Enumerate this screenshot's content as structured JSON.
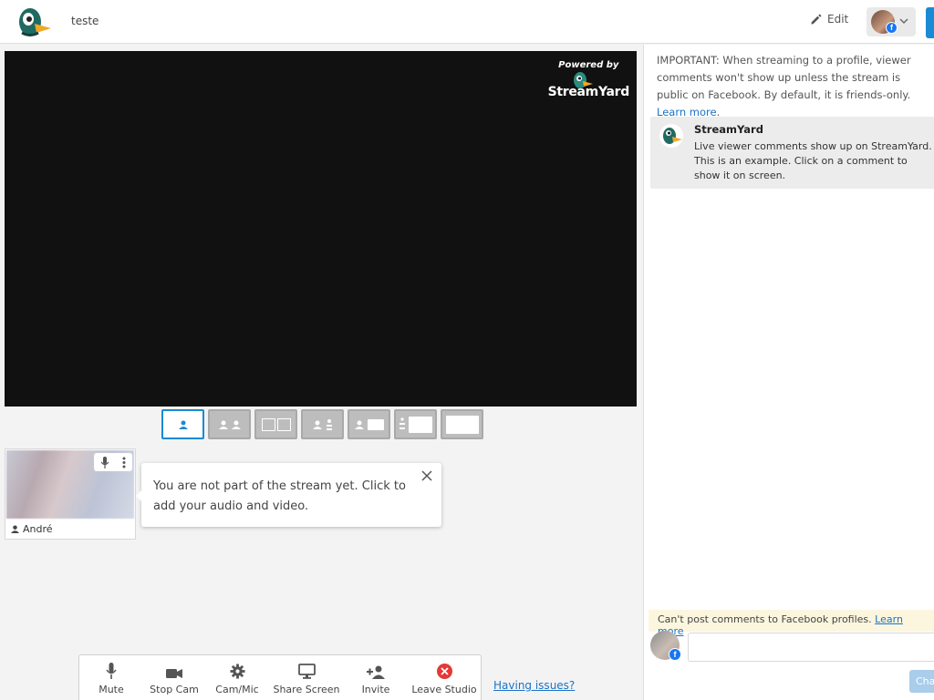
{
  "header": {
    "title": "teste",
    "edit_label": "Edit"
  },
  "stage": {
    "powered_by": "Powered by",
    "brand": "StreamYard"
  },
  "participant": {
    "name": "André"
  },
  "tooltip": {
    "text": "You are not part of the stream yet. Click to add your audio and video."
  },
  "toolbar": {
    "mute": "Mute",
    "stop_cam": "Stop Cam",
    "cam_mic": "Cam/Mic",
    "share_screen": "Share Screen",
    "invite": "Invite",
    "leave_studio": "Leave Studio",
    "having_issues": "Having issues?"
  },
  "panel": {
    "important_text": "IMPORTANT: When streaming to a profile, viewer comments won't show up unless the stream is public on Facebook. By default, it is friends-only. ",
    "important_link": "Learn more",
    "important_end": ".",
    "comment": {
      "author": "StreamYard",
      "text": "Live viewer comments show up on StreamYard. This is an example. Click on a comment to show it on screen."
    },
    "notice_text": "Can't post comments to Facebook profiles. ",
    "notice_link": "Learn more",
    "chat_button": "Chat"
  },
  "colors": {
    "accent": "#1a8ad4",
    "leave": "#e53935",
    "link": "#1a73c8",
    "facebook": "#1877f2"
  },
  "icons": [
    "streamyard-logo-icon",
    "pencil-icon",
    "chevron-down-icon",
    "person-icon",
    "microphone-icon",
    "more-vertical-icon",
    "close-icon",
    "camera-icon",
    "gear-icon",
    "monitor-icon",
    "add-person-icon",
    "leave-icon",
    "facebook-icon"
  ]
}
